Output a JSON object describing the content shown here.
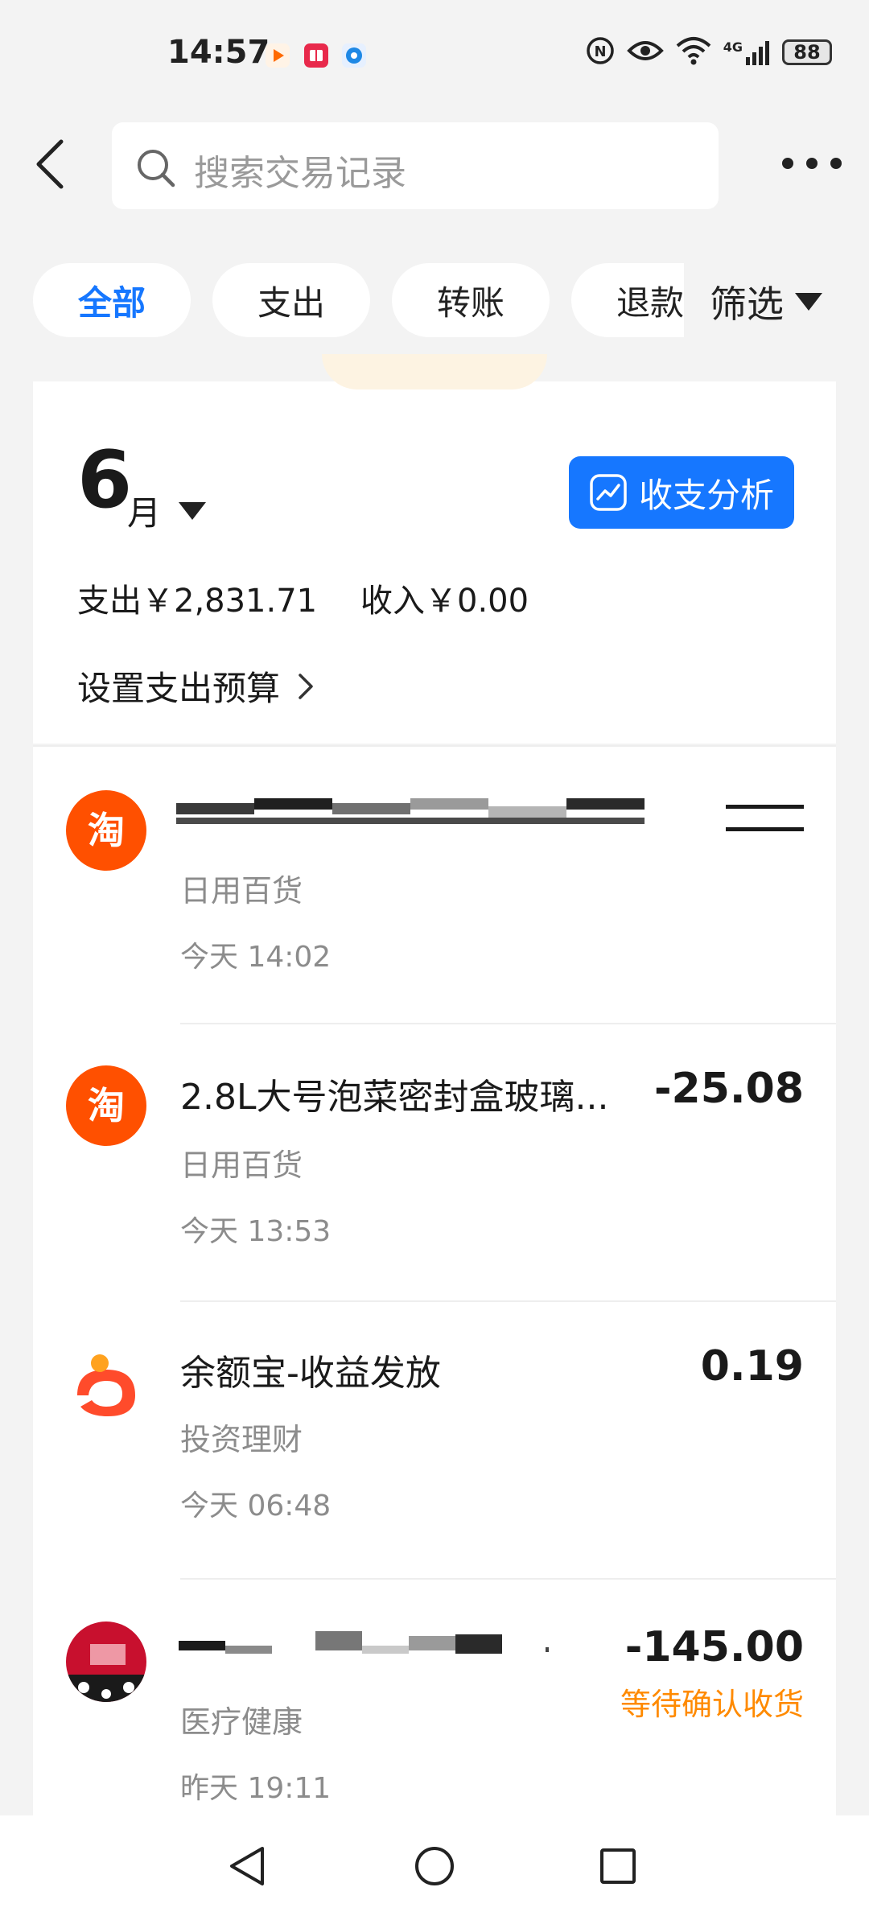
{
  "status_bar": {
    "time": "14:57",
    "network": "4G",
    "battery": "88",
    "notification_icons": [
      "video-app-icon",
      "reader-app-icon",
      "browser-app-icon"
    ]
  },
  "header": {
    "search_placeholder": "搜索交易记录"
  },
  "tabs": [
    {
      "label": "全部",
      "active": true
    },
    {
      "label": "支出",
      "active": false
    },
    {
      "label": "转账",
      "active": false
    },
    {
      "label": "退款",
      "active": false
    }
  ],
  "filter": {
    "label": "筛选"
  },
  "summary": {
    "month_number": "6",
    "month_unit": "月",
    "analysis_button": "收支分析",
    "expense": "支出￥2,831.71",
    "income": "收入￥0.00",
    "budget_link": "设置支出预算"
  },
  "transactions": [
    {
      "title": "",
      "category": "日用百货",
      "time": "今天 14:02",
      "amount": "",
      "status": "",
      "icon": "taobao-icon"
    },
    {
      "title": "2.8L大号泡菜密封盒玻璃...",
      "category": "日用百货",
      "time": "今天 13:53",
      "amount": "-25.08",
      "status": "",
      "icon": "taobao-icon"
    },
    {
      "title": "余额宝-收益发放",
      "category": "投资理财",
      "time": "今天 06:48",
      "amount": "0.19",
      "status": "",
      "icon": "yuebao-icon"
    },
    {
      "title": "",
      "category": "医疗健康",
      "time": "昨天 19:11",
      "amount": "-145.00",
      "status": "等待确认收货",
      "icon": "merchant-avatar-icon"
    }
  ],
  "colors": {
    "accent": "#1677ff",
    "taobao": "#ff5000",
    "pending": "#ff8a00",
    "background": "#f3f3f3"
  }
}
